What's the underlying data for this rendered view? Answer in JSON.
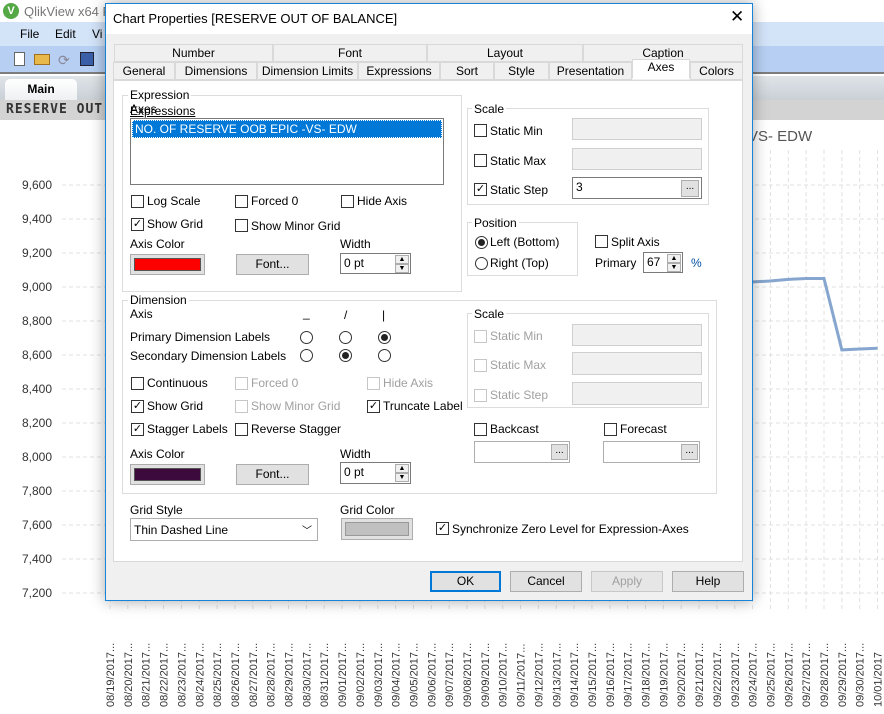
{
  "app": {
    "title": "QlikView x64 Pe",
    "menu": [
      "File",
      "Edit",
      "Vi"
    ],
    "sheet_tab": "Main",
    "sheet_header": "RESERVE OUT (",
    "chart_title_visible": "VS- EDW",
    "colors": {
      "line": "#86a6cf",
      "menubar": "#d3e3f8",
      "toolbar": "#b7cff3"
    }
  },
  "chart_data": {
    "type": "line",
    "title": "VS- EDW",
    "y_ticks": [
      "9,600",
      "9,400",
      "9,200",
      "9,000",
      "8,800",
      "8,600",
      "8,400",
      "8,200",
      "8,000",
      "7,800",
      "7,600",
      "7,400",
      "7,200"
    ],
    "ylim": [
      7200,
      9600
    ],
    "grid": true,
    "categories": [
      "08/19/2017...",
      "08/20/2017...",
      "08/21/2017...",
      "08/22/2017...",
      "08/23/2017...",
      "08/24/2017...",
      "08/25/2017...",
      "08/26/2017...",
      "08/27/2017...",
      "08/28/2017...",
      "08/29/2017...",
      "08/30/2017...",
      "08/31/2017...",
      "09/01/2017...",
      "09/02/2017...",
      "09/03/2017...",
      "09/04/2017...",
      "09/05/2017...",
      "09/06/2017...",
      "09/07/2017...",
      "09/08/2017...",
      "09/09/2017...",
      "09/10/2017...",
      "09/11/2017...",
      "09/12/2017...",
      "09/13/2017...",
      "09/14/2017...",
      "09/15/2017...",
      "09/16/2017...",
      "09/17/2017...",
      "09/18/2017...",
      "09/19/2017...",
      "09/20/2017...",
      "09/21/2017...",
      "09/22/2017...",
      "09/23/2017...",
      "09/24/2017...",
      "09/25/2017...",
      "09/26/2017...",
      "09/27/2017...",
      "09/28/2017...",
      "09/29/2017...",
      "09/30/2017...",
      "10/01/2017"
    ],
    "visible_points": [
      {
        "x": "09/24/2017...",
        "y": 9030
      },
      {
        "x": "09/25/2017...",
        "y": 9035
      },
      {
        "x": "09/26/2017...",
        "y": 9045
      },
      {
        "x": "09/27/2017...",
        "y": 9050
      },
      {
        "x": "09/28/2017...",
        "y": 9050
      },
      {
        "x": "09/29/2017...",
        "y": 8630
      },
      {
        "x": "09/30/2017...",
        "y": 8635
      },
      {
        "x": "10/01/2017",
        "y": 8640
      }
    ]
  },
  "dialog": {
    "title": "Chart Properties [RESERVE OUT OF BALANCE]",
    "tabs_row1": [
      "Number",
      "Font",
      "Layout",
      "Caption"
    ],
    "tabs_row2": [
      "General",
      "Dimensions",
      "Dimension Limits",
      "Expressions",
      "Sort",
      "Style",
      "Presentation",
      "Axes",
      "Colors"
    ],
    "active_tab": "Axes",
    "expr": {
      "group": "Expression Axes",
      "list_label": "Expressions",
      "items": [
        "NO. OF RESERVE OOB EPIC -VS- EDW"
      ],
      "log_scale": "Log Scale",
      "forced0": "Forced 0",
      "hide_axis": "Hide Axis",
      "show_grid": "Show Grid",
      "show_minor_grid": "Show Minor Grid",
      "axis_color": "Axis Color",
      "axis_color_value": "#ff0000",
      "font_btn": "Font...",
      "width_label": "Width",
      "width_value": "0 pt",
      "scale": "Scale",
      "static_min": "Static Min",
      "static_max": "Static Max",
      "static_step": "Static Step",
      "static_step_value": "3",
      "ellipsis": "...",
      "position": "Position",
      "left_bottom": "Left (Bottom)",
      "right_top": "Right (Top)",
      "split_axis": "Split Axis",
      "primary": "Primary",
      "primary_value": "67",
      "percent": "%",
      "checked": {
        "log_scale": false,
        "forced0": false,
        "hide_axis": false,
        "show_grid": true,
        "show_minor_grid": false,
        "static_min": false,
        "static_max": false,
        "static_step": true,
        "split_axis": false
      },
      "position_selected": "Left (Bottom)"
    },
    "dim": {
      "group": "Dimension Axis",
      "col_headers": [
        "_",
        "/",
        "|"
      ],
      "primary_labels": "Primary Dimension Labels",
      "secondary_labels": "Secondary Dimension Labels",
      "primary_selected": "|",
      "secondary_selected": "/",
      "continuous": "Continuous",
      "forced0": "Forced 0",
      "hide_axis": "Hide Axis",
      "show_grid": "Show Grid",
      "show_minor_grid": "Show Minor Grid",
      "truncate_label": "Truncate Label",
      "stagger_labels": "Stagger Labels",
      "reverse_stagger": "Reverse Stagger",
      "axis_color": "Axis Color",
      "axis_color_value": "#3c0a3c",
      "font_btn": "Font...",
      "width_label": "Width",
      "width_value": "0 pt",
      "scale": "Scale",
      "static_min": "Static Min",
      "static_max": "Static Max",
      "static_step": "Static Step",
      "backcast": "Backcast",
      "forecast": "Forecast",
      "checked": {
        "continuous": false,
        "forced0": false,
        "hide_axis": false,
        "show_grid": true,
        "show_minor_grid": false,
        "truncate_label": true,
        "stagger_labels": true,
        "reverse_stagger": false,
        "backcast": false,
        "forecast": false
      }
    },
    "grid_style_label": "Grid Style",
    "grid_style_value": "Thin Dashed Line",
    "grid_color_label": "Grid Color",
    "grid_color_value": "#c0c0c0",
    "sync_zero": "Synchronize Zero Level for Expression-Axes",
    "sync_zero_checked": true,
    "buttons": {
      "ok": "OK",
      "cancel": "Cancel",
      "apply": "Apply",
      "help": "Help"
    }
  }
}
